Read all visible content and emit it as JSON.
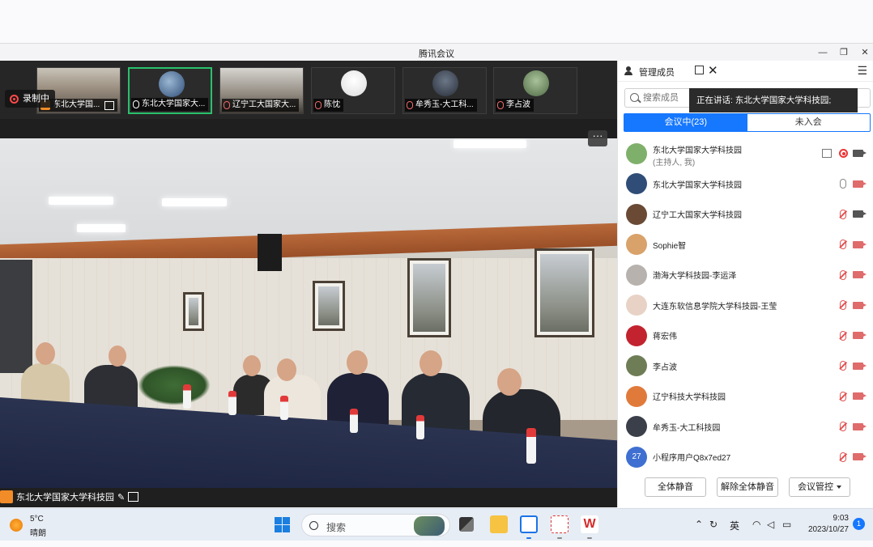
{
  "window": {
    "title": "腾讯会议",
    "minimize": "—",
    "restore": "❐",
    "close": "✕"
  },
  "recording": {
    "label": "录制中"
  },
  "thumbnails": [
    {
      "label": "东北大学国...",
      "mic": "host-share"
    },
    {
      "label": "东北大学国家大...",
      "mic": "on",
      "active": true
    },
    {
      "label": "辽宁工大国家大...",
      "mic": "muted"
    },
    {
      "label": "陈忱",
      "mic": "muted"
    },
    {
      "label": "牟秀玉-大工科...",
      "mic": "muted"
    },
    {
      "label": "李占波",
      "mic": "muted"
    }
  ],
  "main_video": {
    "more_label": "···",
    "speaker_label": "东北大学国家大学科技园"
  },
  "panel": {
    "title": "管理成员",
    "menu_icon": "☰",
    "close": "✕",
    "search_placeholder": "搜索成员",
    "speaking_prefix": "正在讲话:",
    "speaking_name": "东北大学国家大学科技园;",
    "tab_in": "会议中(23)",
    "tab_out": "未入会",
    "members": [
      {
        "name": "东北大学国家大学科技园",
        "sub": "(主持人, 我)",
        "mic": "share-rec",
        "cam": "on",
        "avatar": "#7fb06b"
      },
      {
        "name": "东北大学国家大学科技园",
        "mic": "on",
        "cam": "off",
        "avatar": "#2f4d77"
      },
      {
        "name": "辽宁工大国家大学科技园",
        "mic": "muted",
        "cam": "on",
        "avatar": "#6a4a35"
      },
      {
        "name": "Sophie智",
        "mic": "muted",
        "cam": "off",
        "avatar": "#d8a26a"
      },
      {
        "name": "渤海大学科技园-李运泽",
        "mic": "muted",
        "cam": "off",
        "avatar": "#b7b2ad"
      },
      {
        "name": "大连东软信息学院大学科技园-王莹",
        "mic": "muted",
        "cam": "off",
        "avatar": "#e8d2c6"
      },
      {
        "name": "蒋宏伟",
        "mic": "muted",
        "cam": "off",
        "avatar": "#c2232e"
      },
      {
        "name": "李占波",
        "mic": "muted",
        "cam": "off",
        "avatar": "#6e7d55"
      },
      {
        "name": "辽宁科技大学科技园",
        "mic": "muted",
        "cam": "off",
        "avatar": "#e07a3b"
      },
      {
        "name": "牟秀玉-大工科技园",
        "mic": "muted",
        "cam": "off",
        "avatar": "#3b3f4a"
      },
      {
        "name": "小程序用户Q8x7ed27",
        "mic": "muted",
        "cam": "off",
        "avatar": "#3f6fd1",
        "initial": "27"
      }
    ],
    "btn_mute_all": "全体静音",
    "btn_unmute_all": "解除全体静音",
    "btn_control": "会议管控"
  },
  "taskbar": {
    "temperature": "5°C",
    "weather": "晴朗",
    "search": "搜索",
    "ime": "英",
    "time": "9:03",
    "date": "2023/10/27",
    "notifications": "1"
  },
  "colors": {
    "accent": "#1677ff",
    "active_border": "#29c16c",
    "record": "#ff4a4a"
  }
}
